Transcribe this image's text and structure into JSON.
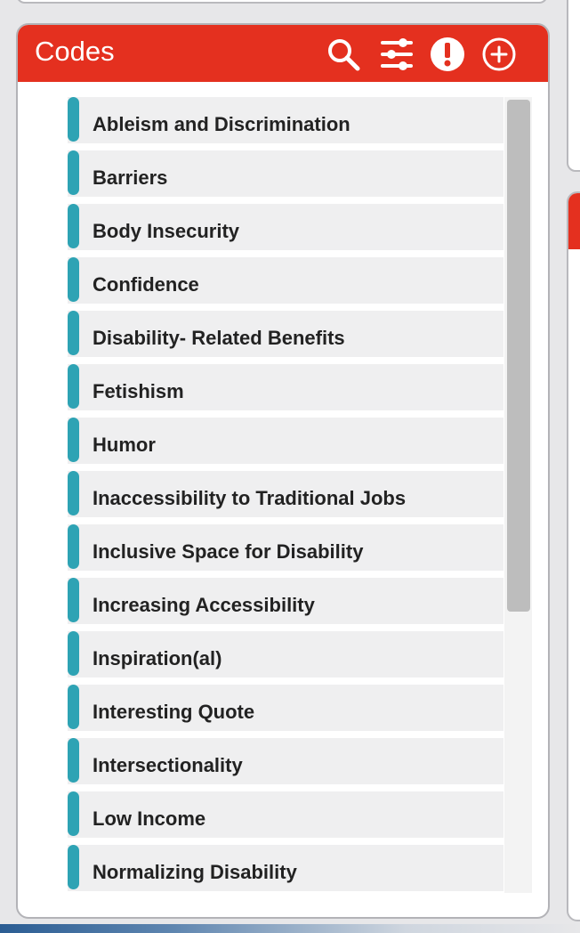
{
  "panel": {
    "title": "Codes",
    "header_color": "#e4301f",
    "actions": [
      {
        "icon": "search-icon"
      },
      {
        "icon": "filter-sliders-icon"
      },
      {
        "icon": "alert-icon"
      },
      {
        "icon": "add-circle-icon"
      }
    ]
  },
  "codes": [
    {
      "label": "Ableism and Discrimination"
    },
    {
      "label": "Barriers"
    },
    {
      "label": "Body Insecurity"
    },
    {
      "label": "Confidence"
    },
    {
      "label": "Disability- Related Benefits"
    },
    {
      "label": "Fetishism"
    },
    {
      "label": "Humor"
    },
    {
      "label": "Inaccessibility to Traditional Jobs"
    },
    {
      "label": "Inclusive Space for Disability"
    },
    {
      "label": "Increasing Accessibility"
    },
    {
      "label": "Inspiration(al)"
    },
    {
      "label": "Interesting Quote"
    },
    {
      "label": "Intersectionality"
    },
    {
      "label": "Low Income"
    },
    {
      "label": "Normalizing Disability"
    }
  ],
  "code_color": "#2ea3b4"
}
